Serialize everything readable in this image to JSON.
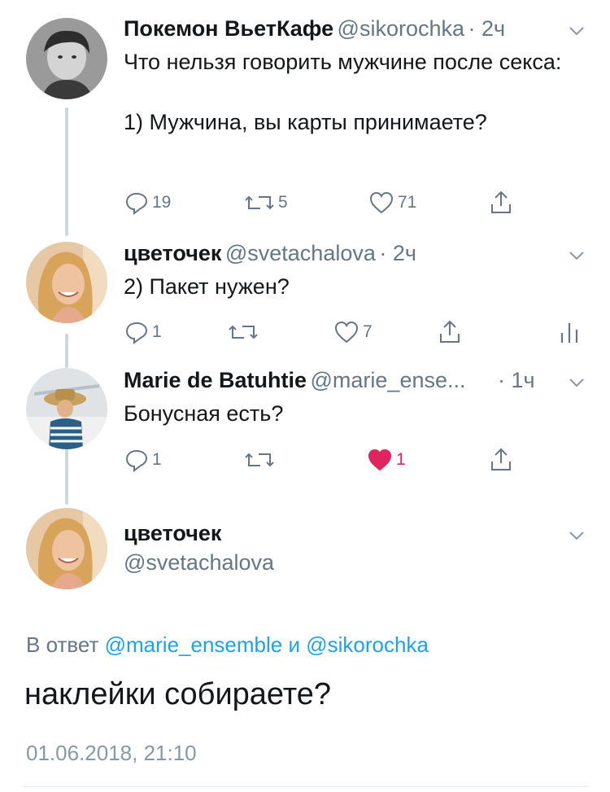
{
  "tweets": [
    {
      "name": "Покемон ВьетКафе",
      "handle": "@sikorochka",
      "time": "· 2ч",
      "text": "Что нельзя говорить мужчине после секса:\n\n1) Мужчина, вы карты принимаете?",
      "replies": "19",
      "retweets": "5",
      "likes": "71"
    },
    {
      "name": "цветочек",
      "handle": "@svetachalova",
      "time": "· 2ч",
      "text": "2) Пакет нужен?",
      "replies": "1",
      "retweets": "",
      "likes": "7"
    },
    {
      "name": "Marie de Batuhtie",
      "handle": "@marie_ense...",
      "time": "· 1ч",
      "text": "Бонусная есть?",
      "replies": "1",
      "retweets": "",
      "likes": "1"
    }
  ],
  "main_tweet": {
    "name": "цветочек",
    "handle": "@svetachalova",
    "reply_prefix": "В ответ",
    "reply_user1": "@marie_ensemble",
    "reply_and": "и",
    "reply_user2": "@sikorochka",
    "text": "наклейки собираете?",
    "timestamp": "01.06.2018, 21:10"
  },
  "colors": {
    "accent": "#1da1f2",
    "like": "#e0245e",
    "muted": "#657786",
    "thread_line": "#ccd6dd"
  }
}
